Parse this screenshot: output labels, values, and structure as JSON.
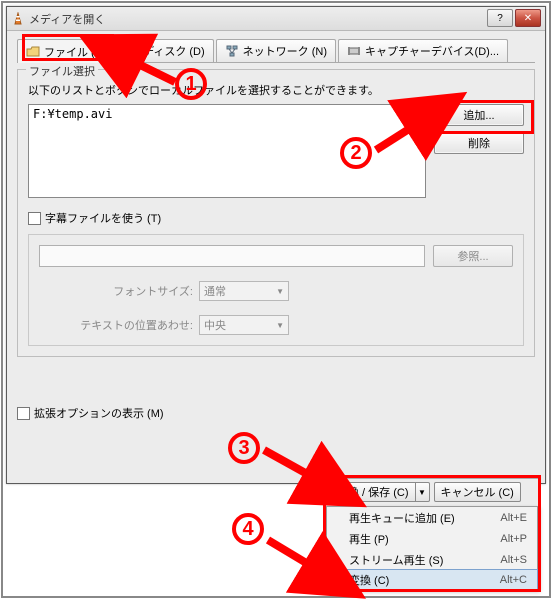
{
  "window": {
    "title": "メディアを開く"
  },
  "tabs": [
    {
      "icon": "folder-icon",
      "label": "ファイル (F)"
    },
    {
      "icon": "disc-icon",
      "label": "ディスク (D)"
    },
    {
      "icon": "network-icon",
      "label": "ネットワーク (N)"
    },
    {
      "icon": "capture-icon",
      "label": "キャプチャーデバイス(D)..."
    }
  ],
  "file_section": {
    "legend": "ファイル選択",
    "instruction": "以下のリストとボタンでローカルファイルを選択することができます。",
    "files": [
      "F:¥temp.avi"
    ],
    "add_btn": "追加...",
    "remove_btn": "削除"
  },
  "subtitle": {
    "checkbox_label": "字幕ファイルを使う (T)",
    "browse_btn": "参照...",
    "font_size_label": "フォントサイズ:",
    "font_size_value": "通常",
    "align_label": "テキストの位置あわせ:",
    "align_value": "中央"
  },
  "extended": {
    "checkbox_label": "拡張オプションの表示 (M)"
  },
  "actions": {
    "main_button": "変換 / 保存 (C)",
    "cancel": "キャンセル (C)",
    "menu": [
      {
        "label": "再生キューに追加 (E)",
        "shortcut": "Alt+E"
      },
      {
        "label": "再生 (P)",
        "shortcut": "Alt+P"
      },
      {
        "label": "ストリーム再生 (S)",
        "shortcut": "Alt+S"
      },
      {
        "label": "変換 (C)",
        "shortcut": "Alt+C"
      }
    ]
  },
  "annotations": {
    "n1": "1",
    "n2": "2",
    "n3": "3",
    "n4": "4"
  }
}
